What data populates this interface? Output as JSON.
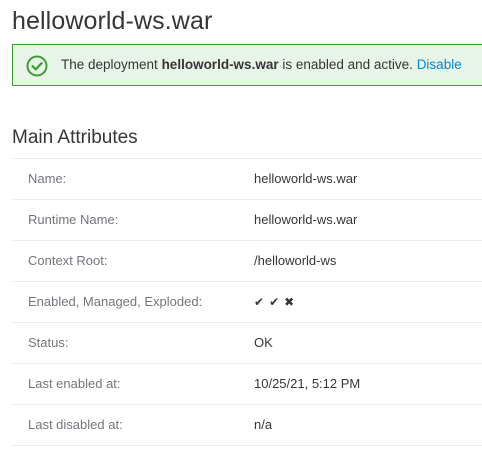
{
  "deployment": {
    "title": "helloworld-ws.war"
  },
  "alert": {
    "prefix": "The deployment ",
    "name": "helloworld-ws.war",
    "suffix": " is enabled and active. ",
    "action_label": "Disable",
    "icon": "check-circle-icon",
    "color": "#3f9c35",
    "background": "#e9f4e9"
  },
  "main_attributes": {
    "title": "Main Attributes",
    "rows": [
      {
        "label": "Name:",
        "value": "helloworld-ws.war"
      },
      {
        "label": "Runtime Name:",
        "value": "helloworld-ws.war"
      },
      {
        "label": "Context Root:",
        "value": "/helloworld-ws"
      },
      {
        "label": "Enabled, Managed, Exploded:",
        "flags": [
          "✔",
          "✔",
          "✖"
        ]
      },
      {
        "label": "Status:",
        "value": "OK"
      },
      {
        "label": "Last enabled at:",
        "value": "10/25/21, 5:12 PM"
      },
      {
        "label": "Last disabled at:",
        "value": "n/a"
      }
    ]
  },
  "colors": {
    "link": "#0088ce",
    "label": "#72767b",
    "text": "#363636"
  }
}
